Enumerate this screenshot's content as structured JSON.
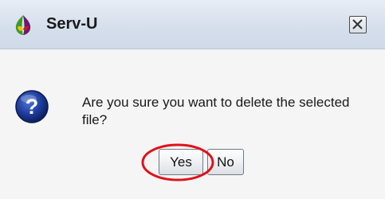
{
  "window": {
    "title": "Serv-U",
    "app_icon": "serv-u-logo-icon",
    "close_icon": "close-icon"
  },
  "dialog": {
    "icon": "question-icon",
    "message": "Are you sure you want to delete the selected file?",
    "buttons": {
      "yes_label": "Yes",
      "no_label": "No"
    }
  },
  "colors": {
    "title_bar": "#d6dfec",
    "body_bg": "#f5f5f6",
    "question_icon": "#1e3c9b",
    "highlight_ring": "#e0121b"
  }
}
